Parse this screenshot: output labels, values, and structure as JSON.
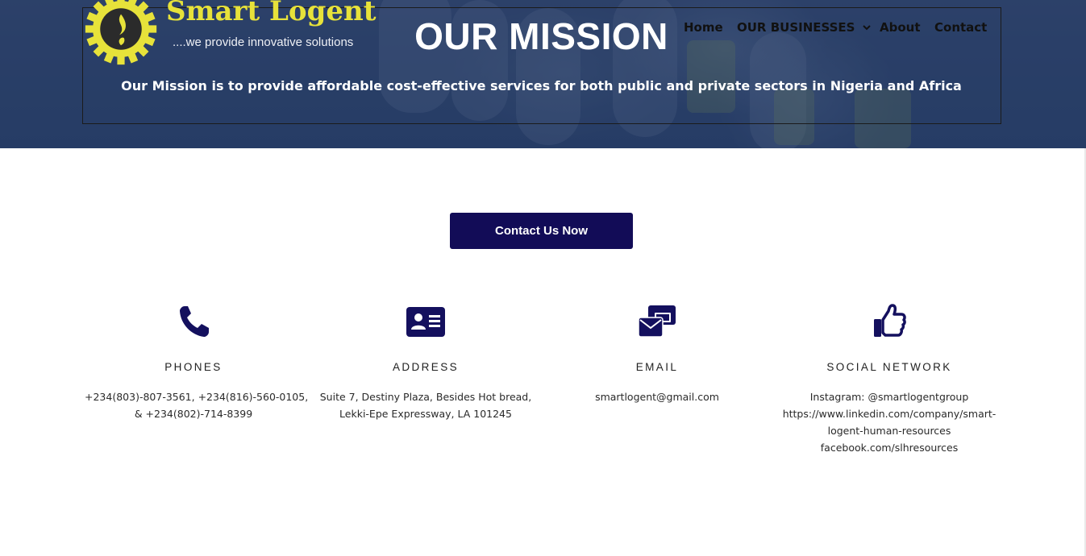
{
  "brand": {
    "name": "Smart Logent",
    "tagline": "....we provide innovative solutions",
    "logo_icon": "gear-flame-icon"
  },
  "nav": {
    "home": "Home",
    "businesses": "OUR BUSINESSES",
    "about": "About",
    "contact": "Contact"
  },
  "hero": {
    "title": "OUR MISSION",
    "subtitle": "Our Mission is to provide affordable cost-effective services for both public and private sectors in Nigeria and Africa"
  },
  "cta": {
    "label": "Contact Us Now"
  },
  "info": {
    "phones": {
      "icon": "phone-icon",
      "heading": "PHONES",
      "lines": [
        "+234(803)-807-3561, +234(816)-560-0105,",
        "& +234(802)-714-8399"
      ]
    },
    "address": {
      "icon": "address-card-icon",
      "heading": "ADDRESS",
      "lines": [
        "Suite 7, Destiny Plaza, Besides Hot bread,",
        "Lekki-Epe Expressway, LA 101245"
      ]
    },
    "email": {
      "icon": "envelope-icon",
      "heading": "EMAIL",
      "lines": [
        "smartlogent@gmail.com"
      ]
    },
    "social": {
      "icon": "thumbs-up-icon",
      "heading": "SOCIAL NETWORK",
      "lines": [
        "Instagram: @smartlogentgroup",
        "https://www.linkedin.com/company/smart-",
        "logent-human-resources",
        "facebook.com/slhresources"
      ]
    }
  },
  "colors": {
    "accent": "#120c57",
    "icon": "#14105e",
    "brand_yellow": "#e7e23a",
    "hero_overlay": "#2e4670"
  }
}
